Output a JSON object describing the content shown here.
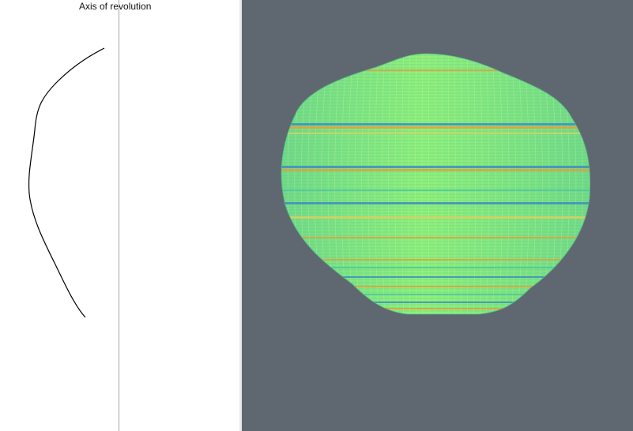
{
  "profile_editor": {
    "axis_label": "Axis of revolution"
  },
  "viewport_3d": {
    "background_color": "#5f6870",
    "mesh_base_color": "#7fe27a",
    "mesh_grid_color": "#5ac98c",
    "band_colors": [
      "#e0a040",
      "#3d8fc0",
      "#d8d060",
      "#4fc7a0"
    ]
  }
}
